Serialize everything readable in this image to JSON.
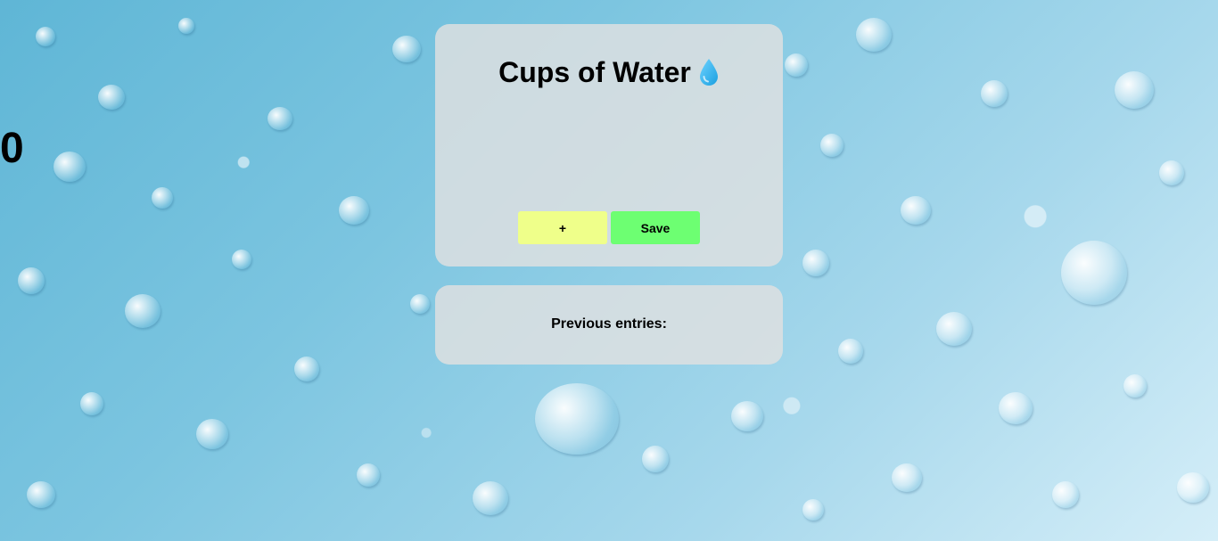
{
  "header": {
    "title": "Cups of Water",
    "icon": "water-drop-icon",
    "icon_color": "#2bb6f0"
  },
  "counter": {
    "value": "0"
  },
  "buttons": {
    "increment_label": "+",
    "increment_color": "#efff8a",
    "save_label": "Save",
    "save_color": "#6dff72"
  },
  "history": {
    "heading": "Previous entries:",
    "entries": []
  }
}
